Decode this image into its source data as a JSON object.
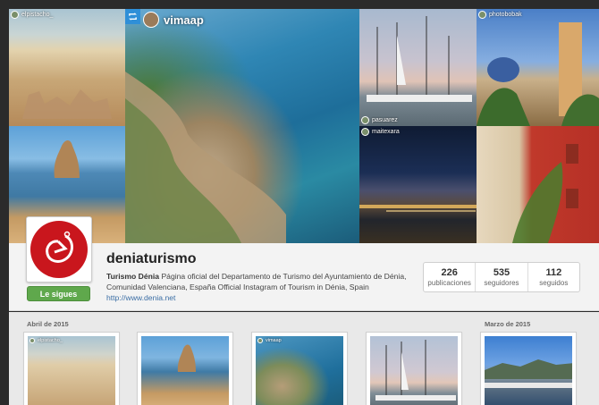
{
  "mosaic": {
    "tile_users": {
      "top_left": "elpistacho_",
      "feature": "vimaap",
      "harbor": "pasuarez",
      "night": "maitexara",
      "church": "photobobak"
    }
  },
  "profile": {
    "username": "deniaturismo",
    "display_name": "Turismo Dénia",
    "bio": "Página oficial del Departamento de Turismo del Ayuntamiento de Dénia, Comunidad Valenciana, España Official Instagram of Tourism in Dénia, Spain",
    "website": "http://www.denia.net",
    "follow_label": "Le sigues",
    "stats": [
      {
        "value": "226",
        "label": "publicaciones"
      },
      {
        "value": "535",
        "label": "seguidores"
      },
      {
        "value": "112",
        "label": "seguidos"
      }
    ],
    "brand_color": "#c9161d",
    "follow_color": "#5fa84c"
  },
  "feed": {
    "months": [
      "Abril de 2015",
      "Marzo de 2015"
    ],
    "thumb_users": {
      "thumb1": "elpistacho_",
      "thumb3": "vimaap"
    }
  }
}
